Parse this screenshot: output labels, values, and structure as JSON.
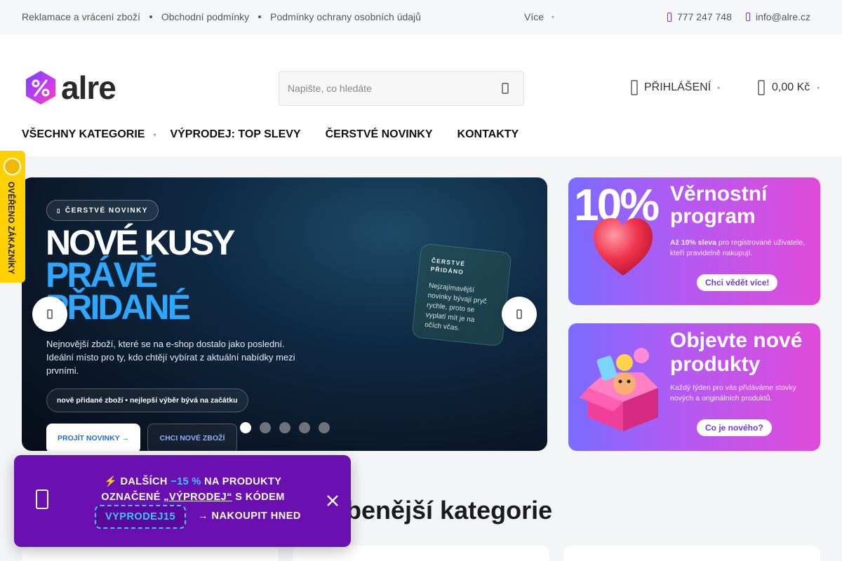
{
  "topbar": {
    "links": [
      "Reklamace a vrácení zboží",
      "Obchodní podmínky",
      "Podmínky ochrany osobních údajů"
    ],
    "more_label": "Více",
    "phone": "777 247 748",
    "email": "info@alre.cz"
  },
  "header": {
    "logo_text": "alre",
    "search_placeholder": "Napište, co hledáte",
    "login_label": "PŘIHLÁŠENÍ",
    "cart_total": "0,00 Kč"
  },
  "nav": {
    "items": [
      "VŠECHNY KATEGORIE",
      "VÝPRODEJ: TOP SLEVY",
      "ČERSTVÉ NOVINKY",
      "KONTAKTY"
    ]
  },
  "verified_tab": {
    "label": "OVĚŘENO ZÁKAZNÍKY"
  },
  "hero": {
    "pill": "ČERSTVÉ NOVINKY",
    "title_line1": "NOVÉ KUSY",
    "title_line2": "PRÁVĚ",
    "title_line3": "PŘIDANÉ",
    "description": "Nejnovější zboží, které se na e-shop dostalo jako poslední. Ideální místo pro ty, kdo chtějí vybírat z aktuální nabídky mezi prvními.",
    "feature": "nově přidané zboží • nejlepší výběr bývá na začátku",
    "button_primary": "PROJÍT NOVINKY →",
    "button_secondary": "CHCI NOVÉ ZBOŽÍ",
    "card_title": "ČERSTVÉ PŘIDÁNO",
    "card_text": "Nejzajímavější novinky bývají pryč rychle, proto se vyplatí mít je na očích včas.",
    "slide_count": 5,
    "active_slide": 1
  },
  "banners": [
    {
      "title_prefix": "10%",
      "title": "Věrnostní program",
      "subtitle_bold": "Až 10% sleva",
      "subtitle": "pro registrované uživatele, kteří pravidelně nakupují.",
      "button": "Chci vědět více!"
    },
    {
      "title": "Objevte nové produkty",
      "subtitle": "Každý týden pro vás přidáváme stovky nových a originálních produktů.",
      "button": "Co je nového?"
    }
  ],
  "categories": {
    "title": "ibenější kategorie"
  },
  "promo": {
    "prefix": "⚡ DALŠÍCH",
    "discount": "−15 %",
    "mid": "NA PRODUKTY OZNAČENÉ",
    "tag": "„VÝPRODEJ“",
    "suffix": "S KÓDEM",
    "code": "VYPRODEJ15",
    "cta": "→ NAKOUPIT HNED"
  },
  "colors": {
    "accent_purple": "#6a0fb0",
    "accent_cyan": "#3ec5ff",
    "verified_yellow": "#ffd100"
  }
}
